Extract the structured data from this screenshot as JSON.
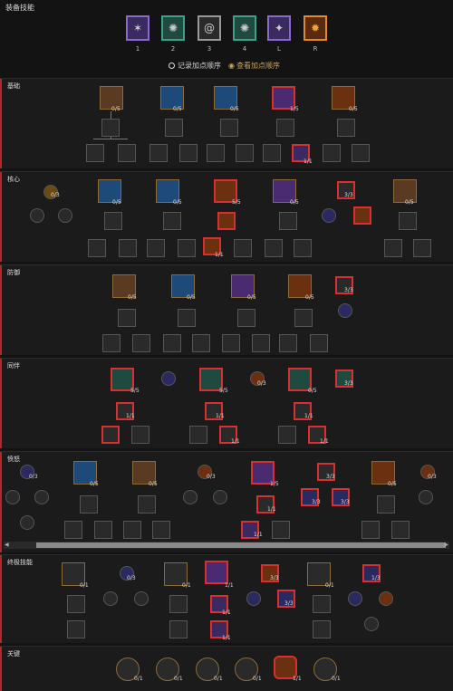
{
  "header": {
    "title": "装备技能"
  },
  "slots": [
    {
      "label": "1",
      "color": "#8a6ad0",
      "bg": "#3a2a60"
    },
    {
      "label": "2",
      "color": "#3fa08a",
      "bg": "#1f4a40"
    },
    {
      "label": "3",
      "color": "#999",
      "bg": "#2a2a2a"
    },
    {
      "label": "4",
      "color": "#3fa08a",
      "bg": "#1f4a40"
    },
    {
      "label": "L",
      "color": "#8a6ad0",
      "bg": "#3a2a60"
    },
    {
      "label": "R",
      "color": "#e08a30",
      "bg": "#5a2a10"
    }
  ],
  "options": {
    "record": "记录加点顺序",
    "view": "查看加点顺序"
  },
  "sections": {
    "basic": "基础",
    "core": "核心",
    "defense": "防御",
    "companion": "同伴",
    "wrath": "愤怒",
    "ultimate": "终极技能",
    "key": "关键"
  },
  "counts": {
    "c05": "0/5",
    "c15": "1/5",
    "c55": "5/5",
    "c03": "0/3",
    "c33": "3/3",
    "c13": "1/3",
    "c11": "1/1",
    "c01": "0/1"
  }
}
